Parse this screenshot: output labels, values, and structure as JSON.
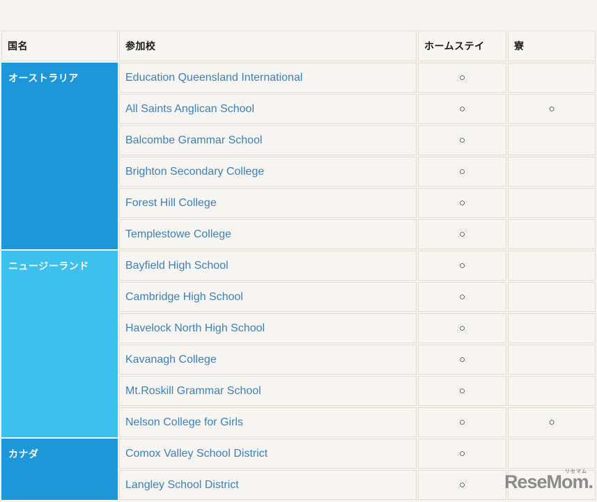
{
  "table": {
    "headers": {
      "country": "国名",
      "school": "参加校",
      "homestay": "ホームステイ",
      "dorm": "寮"
    },
    "groups": [
      {
        "country": "オーストラリア",
        "schools": [
          {
            "name": "Education Queensland International",
            "homestay": "○",
            "dorm": ""
          },
          {
            "name": "All Saints Anglican School",
            "homestay": "○",
            "dorm": "○"
          },
          {
            "name": "Balcombe Grammar School",
            "homestay": "○",
            "dorm": ""
          },
          {
            "name": "Brighton Secondary College",
            "homestay": "○",
            "dorm": ""
          },
          {
            "name": "Forest Hill College",
            "homestay": "○",
            "dorm": ""
          },
          {
            "name": "Templestowe College",
            "homestay": "○",
            "dorm": ""
          }
        ]
      },
      {
        "country": "ニュージーランド",
        "schools": [
          {
            "name": "Bayfield High School",
            "homestay": "○",
            "dorm": ""
          },
          {
            "name": "Cambridge High School",
            "homestay": "○",
            "dorm": ""
          },
          {
            "name": "Havelock North High School",
            "homestay": "○",
            "dorm": ""
          },
          {
            "name": "Kavanagh College",
            "homestay": "○",
            "dorm": ""
          },
          {
            "name": "Mt.Roskill Grammar School",
            "homestay": "○",
            "dorm": ""
          },
          {
            "name": "Nelson College for Girls",
            "homestay": "○",
            "dorm": "○"
          }
        ]
      },
      {
        "country": "カナダ",
        "schools": [
          {
            "name": "Comox Valley School District",
            "homestay": "○",
            "dorm": ""
          },
          {
            "name": "Langley School District",
            "homestay": "○",
            "dorm": ""
          }
        ]
      }
    ]
  },
  "watermark": {
    "text": "ReseMom",
    "dot": ".",
    "ruby": "リセマム"
  },
  "colors": {
    "country_dark": "#1e97da",
    "country_light": "#3cc0ee",
    "link_blue": "#3e7fb8",
    "page_bg": "#f5f4f0",
    "cell_bg": "#f6f5f1",
    "logo_gray": "#8b8b8b"
  }
}
